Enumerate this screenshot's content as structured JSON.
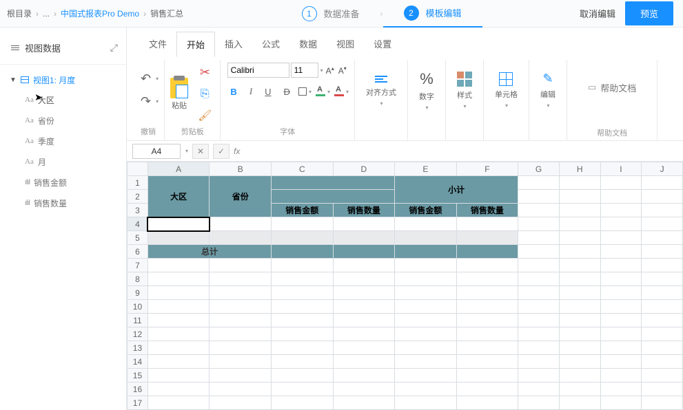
{
  "breadcrumb": {
    "root": "根目录",
    "ellipsis": "...",
    "project": "中国式报表Pro Demo",
    "page": "销售汇总"
  },
  "steps": {
    "s1_num": "1",
    "s1_label": "数据准备",
    "s2_num": "2",
    "s2_label": "模板编辑"
  },
  "top": {
    "cancel": "取消编辑",
    "preview": "预览"
  },
  "side": {
    "title": "视图数据",
    "view1": "视图1: 月度",
    "fields": {
      "f0": "大区",
      "f1": "省份",
      "f2": "季度",
      "f3": "月",
      "f4": "销售金额",
      "f5": "销售数量"
    },
    "icon_text": "Aa",
    "icon_num": "ılıl"
  },
  "tabs": {
    "t0": "文件",
    "t1": "开始",
    "t2": "插入",
    "t3": "公式",
    "t4": "数据",
    "t5": "视图",
    "t6": "设置"
  },
  "ribbon": {
    "undo_group": "撤销",
    "clip_group": "剪贴板",
    "paste": "粘贴",
    "font_group": "字体",
    "font_family": "Calibri",
    "font_size": "11",
    "align": "对齐方式",
    "number": "数字",
    "style": "样式",
    "cells": "单元格",
    "edit": "编辑",
    "help_group": "帮助文档",
    "help_btn": "帮助文档"
  },
  "fx": {
    "ref": "A4",
    "label": "fx"
  },
  "cols": {
    "A": "A",
    "B": "B",
    "C": "C",
    "D": "D",
    "E": "E",
    "F": "F",
    "G": "G",
    "H": "H",
    "I": "I",
    "J": "J"
  },
  "rows": {
    "r1": "1",
    "r2": "2",
    "r3": "3",
    "r4": "4",
    "r5": "5",
    "r6": "6",
    "r7": "7",
    "r8": "8",
    "r9": "9",
    "r10": "10",
    "r11": "11",
    "r12": "12",
    "r13": "13",
    "r14": "14",
    "r15": "15",
    "r16": "16",
    "r17": "17"
  },
  "cells": {
    "region": "大区",
    "province": "省份",
    "subtotal": "小计",
    "sales_amount": "销售金额",
    "sales_qty": "销售数量",
    "total": "总计"
  }
}
